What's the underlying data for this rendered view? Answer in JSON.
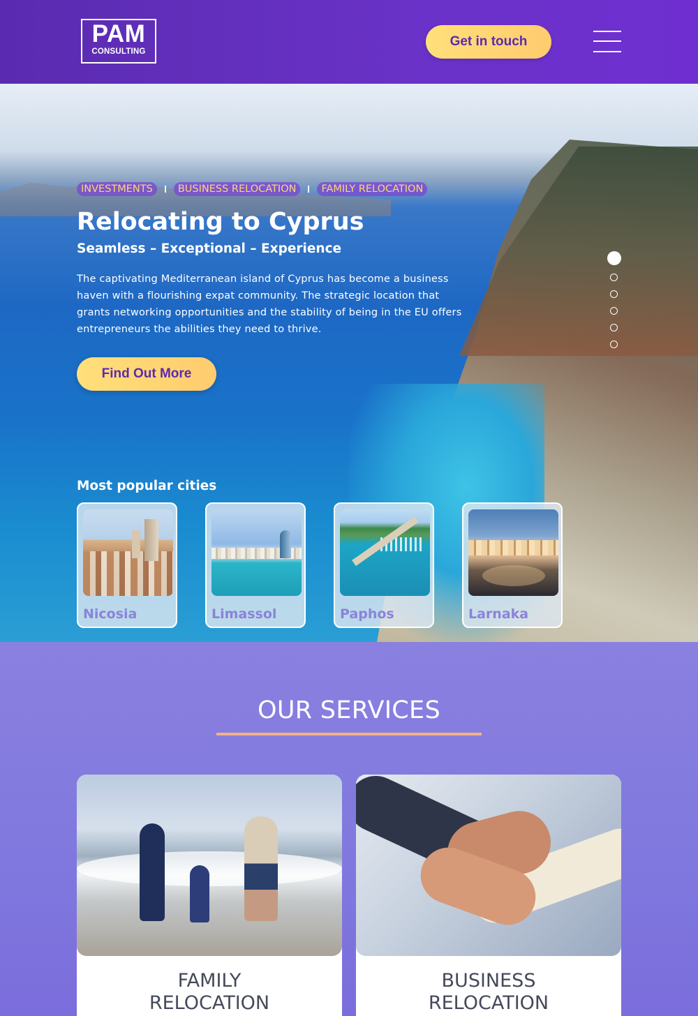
{
  "header": {
    "logo_main": "PAM",
    "logo_sub": "CONSULTING",
    "cta_label": "Get in touch",
    "menu_icon": "hamburger-menu-icon"
  },
  "hero": {
    "tags": [
      "INVESTMENTS",
      "BUSINESS RELOCATION",
      "FAMILY RELOCATION"
    ],
    "title": "Relocating to Cyprus",
    "subtitle": "Seamless – Exceptional – Experience",
    "body": "The captivating Mediterranean island of Cyprus has become a business haven with a flourishing expat community. The strategic location that grants networking opportunities and the stability of being in the EU offers entrepreneurs the abilities they need to thrive.",
    "button_label": "Find Out More",
    "slider": {
      "total": 6,
      "active": 1
    },
    "cities_title": "Most popular cities",
    "cities": [
      {
        "name": "Nicosia"
      },
      {
        "name": "Limassol"
      },
      {
        "name": "Paphos"
      },
      {
        "name": "Larnaka"
      }
    ]
  },
  "services": {
    "title": "OUR SERVICES",
    "cards": [
      {
        "title_line1": "FAMILY",
        "title_line2": "RELOCATION"
      },
      {
        "title_line1": "BUSINESS",
        "title_line2": "RELOCATION"
      }
    ]
  },
  "colors": {
    "header_purple": "#5a2bb0",
    "accent_yellow": "#ffd37a",
    "services_bg": "#8a80e0",
    "underline": "#f2b388",
    "city_name": "#8a83d8"
  }
}
